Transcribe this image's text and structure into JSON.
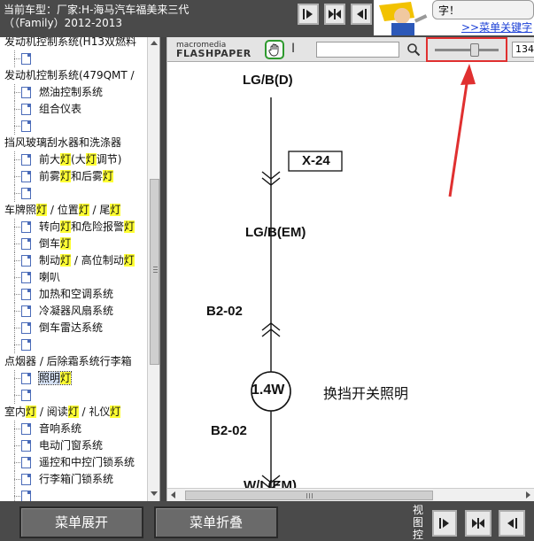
{
  "header": {
    "vehicle_line1": "当前车型：厂家:H-海马汽车福美来三代",
    "vehicle_line2": "（（Family）2012-2013"
  },
  "ad": {
    "bubble_text": "字！",
    "link_text": ">>菜单关键字"
  },
  "tree": {
    "rows": [
      {
        "kind": "cat",
        "text": "发动机控制系统(H13双燃料"
      },
      {
        "kind": "leaf",
        "text": ""
      },
      {
        "kind": "cat",
        "text": "发动机控制系统(479QMT /"
      },
      {
        "kind": "leaf",
        "text": "燃油控制系统"
      },
      {
        "kind": "leaf",
        "text": "组合仪表"
      },
      {
        "kind": "leaf",
        "text": ""
      },
      {
        "kind": "cat",
        "text": "挡风玻璃刮水器和洗涤器"
      },
      {
        "kind": "leaf",
        "text": "前大灯(大灯调节)"
      },
      {
        "kind": "leaf",
        "text": "前雾灯和后雾灯"
      },
      {
        "kind": "leaf",
        "text": ""
      },
      {
        "kind": "cat",
        "text": "车牌照灯 / 位置灯 / 尾灯"
      },
      {
        "kind": "leaf",
        "text": "转向灯和危险报警灯"
      },
      {
        "kind": "leaf",
        "text": "倒车灯"
      },
      {
        "kind": "leaf",
        "text": "制动灯 / 高位制动灯"
      },
      {
        "kind": "leaf",
        "text": "喇叭"
      },
      {
        "kind": "leaf",
        "text": "加热和空调系统"
      },
      {
        "kind": "leaf",
        "text": "冷凝器风扇系统"
      },
      {
        "kind": "leaf",
        "text": "倒车雷达系统"
      },
      {
        "kind": "leaf",
        "text": ""
      },
      {
        "kind": "cat",
        "text": "点烟器 / 后除霜系统行李箱"
      },
      {
        "kind": "leaf",
        "text": "照明灯",
        "selected": true
      },
      {
        "kind": "leaf",
        "text": ""
      },
      {
        "kind": "cat",
        "text": "室内灯 / 阅读灯 / 礼仪灯"
      },
      {
        "kind": "leaf",
        "text": "音响系统"
      },
      {
        "kind": "leaf",
        "text": "电动门窗系统"
      },
      {
        "kind": "leaf",
        "text": "遥控和中控门锁系统"
      },
      {
        "kind": "leaf",
        "text": "行李箱门锁系统"
      },
      {
        "kind": "leaf",
        "text": ""
      }
    ]
  },
  "viewer": {
    "logo_top": "macromedia",
    "logo_bottom": "FLASHPAPER",
    "text_tool": "I",
    "search_value": "",
    "zoom_value": "134",
    "zoom_level_fraction": 0.62
  },
  "diagram": {
    "label_top": "LG/B(D)",
    "connector_x24": "X-24",
    "label_mid": "LG/B(EM)",
    "connector_b202_a": "B2-02",
    "bulb_label": "1.4W",
    "bulb_caption": "换挡开关照明",
    "connector_b202_b": "B2-02",
    "label_bottom": "W/L(EM)"
  },
  "footer": {
    "expand_label": "菜单展开",
    "collapse_label": "菜单折叠",
    "view_control_label": "视图控"
  },
  "colors": {
    "annotation_red": "#e03030",
    "highlight_yellow": "#ffff33",
    "link_blue": "#1a3fd6"
  }
}
